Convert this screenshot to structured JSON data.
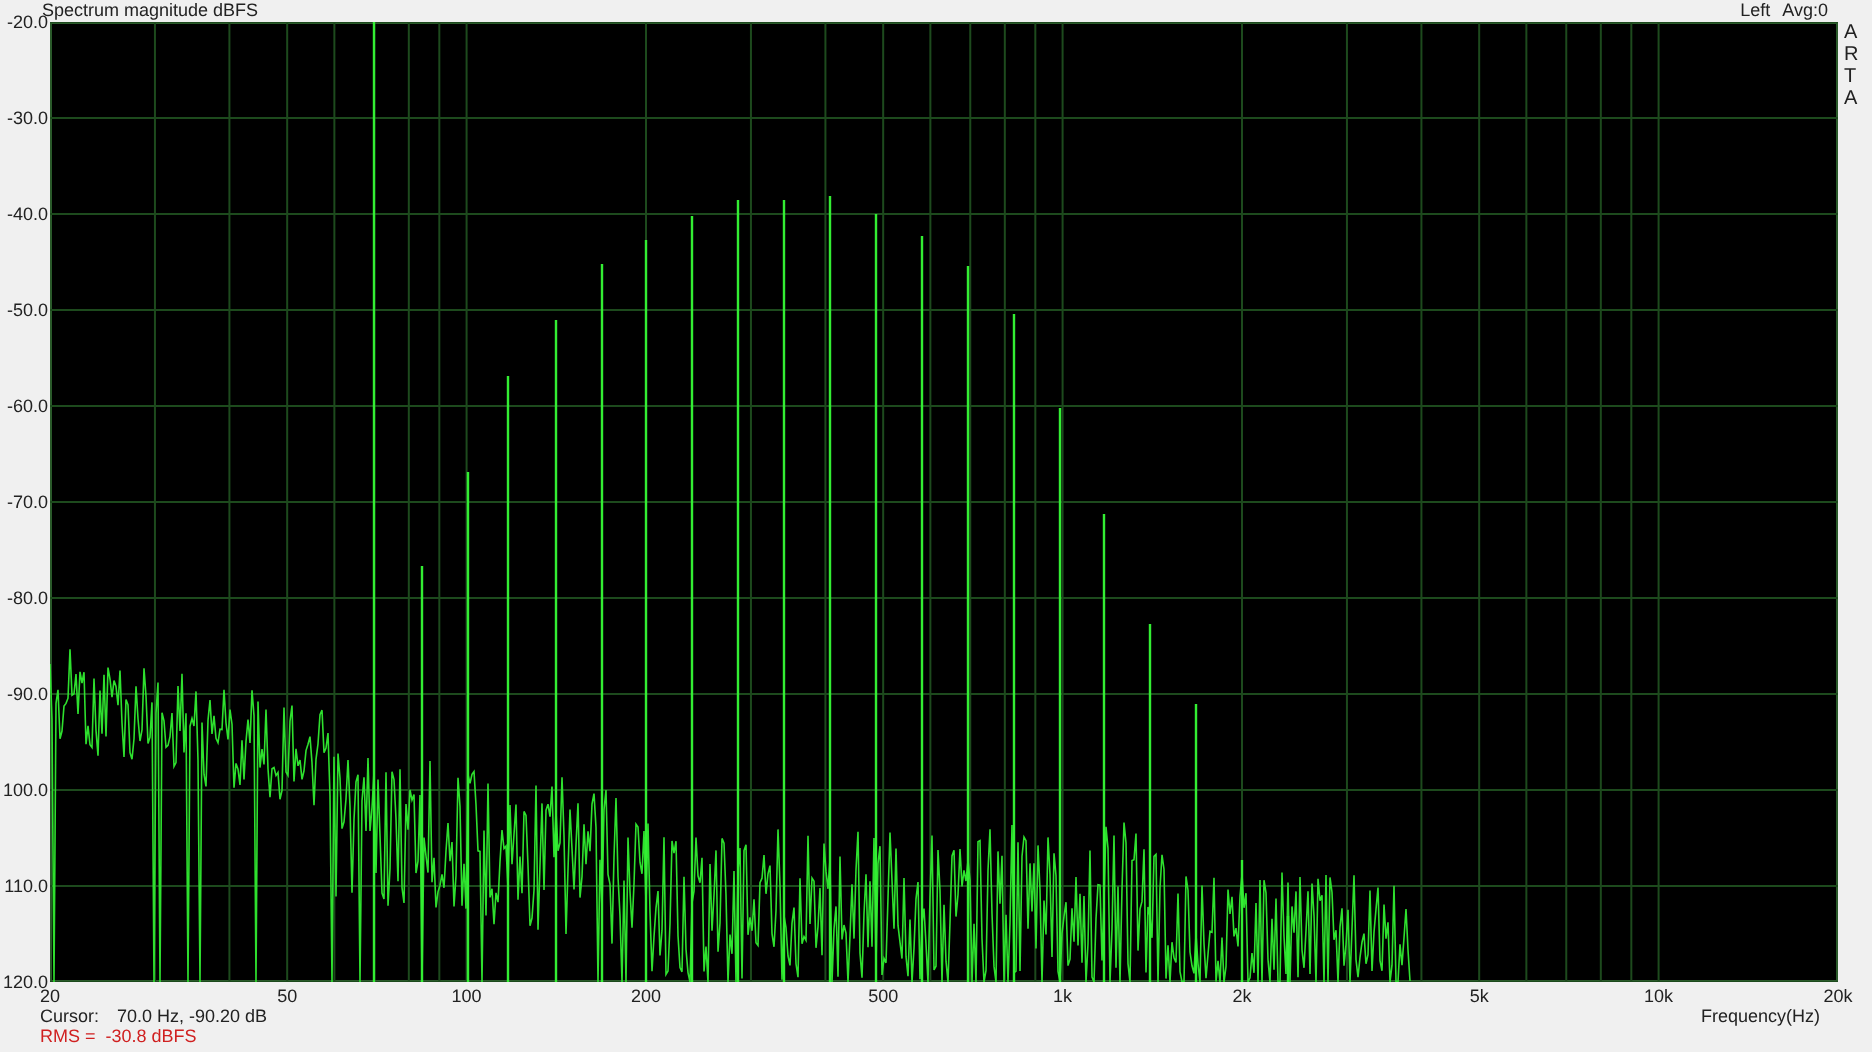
{
  "title": "Spectrum magnitude dBFS",
  "channel": "Left",
  "average": "Avg:0",
  "side_label": "ARTA",
  "y_ticks": [
    "-20.0",
    "-30.0",
    "-40.0",
    "-50.0",
    "-60.0",
    "-70.0",
    "-80.0",
    "-90.0",
    "100.0",
    "110.0",
    "120.0"
  ],
  "x_ticks": [
    "20",
    "50",
    "100",
    "200",
    "500",
    "1k",
    "2k",
    "5k",
    "10k",
    "20k"
  ],
  "xlabel": "Frequency(Hz)",
  "cursor": {
    "label": "Cursor:",
    "value": "70.0 Hz, -90.20 dB"
  },
  "rms": "RMS =  -30.8 dBFS"
}
